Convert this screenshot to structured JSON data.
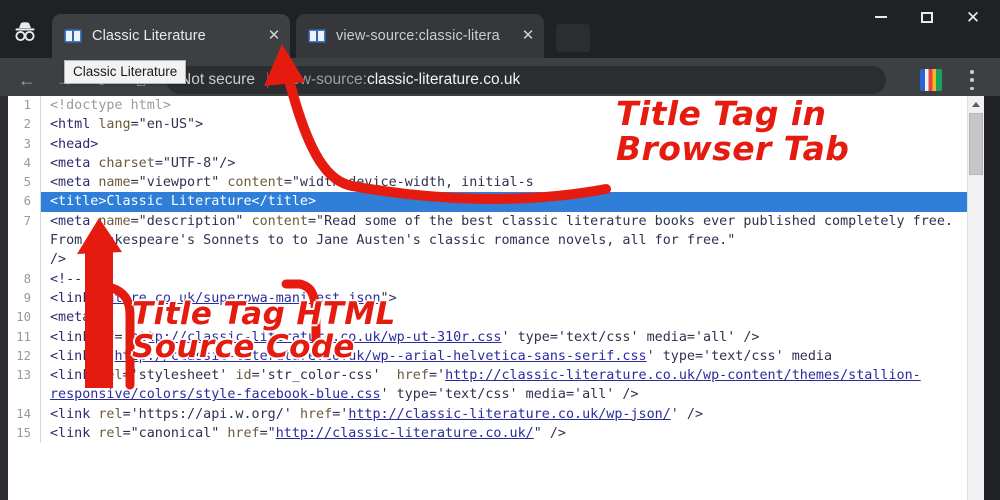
{
  "window": {
    "minimize_label": "Minimize",
    "maximize_label": "Maximize",
    "close_label": "Close",
    "close_glyph": "✕"
  },
  "browser": {
    "mode_icon": "incognito-icon",
    "tabs": [
      {
        "title": "Classic Literature",
        "favicon": "book-favicon",
        "close_glyph": "✕",
        "active": true
      },
      {
        "title": "view-source:classic-litera",
        "favicon": "book-favicon",
        "close_glyph": "✕",
        "active": false
      }
    ],
    "toolbar": {
      "back_glyph": "←",
      "forward_glyph": "→",
      "reload_glyph": "⟳",
      "home_glyph": "⌂",
      "security_label": "Not secure",
      "url_scheme": "view-source:",
      "url_host": "classic-literature.co.uk",
      "extension_icon": "extension-icon",
      "menu_icon": "three-dots-menu-icon"
    },
    "tooltip": "Classic Literature"
  },
  "annotations": [
    {
      "id": "tab-annotation",
      "text": "Title Tag in\nBrowser Tab",
      "color": "#e51b10"
    },
    {
      "id": "source-annotation",
      "text": "Title Tag HTML\nSource Code",
      "color": "#e51b10"
    }
  ],
  "source": {
    "lines": [
      {
        "num": "1",
        "segments": [
          {
            "t": "<!doctype html>",
            "c": "doctypec"
          }
        ]
      },
      {
        "num": "2",
        "segments": [
          {
            "t": "<html ",
            "c": "tagc"
          },
          {
            "t": "lang",
            "c": "attrc"
          },
          {
            "t": "=\"en-US\">",
            "c": "valc"
          }
        ]
      },
      {
        "num": "3",
        "segments": [
          {
            "t": "<head>",
            "c": "tagc"
          }
        ]
      },
      {
        "num": "4",
        "segments": [
          {
            "t": "<meta ",
            "c": "tagc"
          },
          {
            "t": "charset",
            "c": "attrc"
          },
          {
            "t": "=\"UTF-8\"/>",
            "c": "valc"
          }
        ]
      },
      {
        "num": "5",
        "segments": [
          {
            "t": "<meta ",
            "c": "tagc"
          },
          {
            "t": "name",
            "c": "attrc"
          },
          {
            "t": "=\"viewport\" ",
            "c": "valc"
          },
          {
            "t": "content",
            "c": "attrc"
          },
          {
            "t": "=\"width=device-width, initial-s",
            "c": "valc"
          }
        ]
      },
      {
        "num": "6",
        "selected": true,
        "segments": [
          {
            "t": "<title>Classic Literature</title>",
            "c": "tagc"
          }
        ]
      },
      {
        "num": "7",
        "segments": [
          {
            "t": "<meta ",
            "c": "tagc"
          },
          {
            "t": "name",
            "c": "attrc"
          },
          {
            "t": "=\"description\" ",
            "c": "valc"
          },
          {
            "t": "content",
            "c": "attrc"
          },
          {
            "t": "=\"Read some of the best classic literature books ever published completely free. From Shakespeare's Sonnets to to Jane Austen's classic romance novels, all for free.\"\n/>",
            "c": "valc"
          }
        ]
      },
      {
        "num": "8",
        "segments": [
          {
            "t": "<!-- ",
            "c": "tagc"
          }
        ]
      },
      {
        "num": "9",
        "segments": [
          {
            "t": "<link ",
            "c": "tagc"
          },
          {
            "t": "rature.co.uk/superpwa-manifest.json",
            "c": "linkc"
          },
          {
            "t": "\">",
            "c": "valc"
          }
        ]
      },
      {
        "num": "10",
        "segments": [
          {
            "t": "<meta ",
            "c": "tagc"
          }
        ]
      },
      {
        "num": "11",
        "segments": [
          {
            "t": "<link ",
            "c": "tagc"
          },
          {
            "t": "ef='",
            "c": "valc"
          },
          {
            "t": "http://classic-literature.co.uk/wp-ut-310r.css",
            "c": "linkc"
          },
          {
            "t": "' type='text/css' media='all' />",
            "c": "valc"
          }
        ]
      },
      {
        "num": "12",
        "segments": [
          {
            "t": "<link ",
            "c": "tagc"
          },
          {
            "t": "='",
            "c": "valc"
          },
          {
            "t": "http://classic-literature.co.uk/wp--arial-helvetica-sans-serif.css",
            "c": "linkc"
          },
          {
            "t": "' type='text/css' media",
            "c": "valc"
          }
        ]
      },
      {
        "num": "13",
        "segments": [
          {
            "t": "<link ",
            "c": "tagc"
          },
          {
            "t": "rel",
            "c": "attrc"
          },
          {
            "t": "='stylesheet' ",
            "c": "valc"
          },
          {
            "t": "id",
            "c": "attrc"
          },
          {
            "t": "='str_color-css'  ",
            "c": "valc"
          },
          {
            "t": "href",
            "c": "attrc"
          },
          {
            "t": "='",
            "c": "valc"
          },
          {
            "t": "http://classic-literature.co.uk/wp-content/themes/stallion-responsive/colors/style-facebook-blue.css",
            "c": "linkc"
          },
          {
            "t": "' type='text/css' media='all' />",
            "c": "valc"
          }
        ]
      },
      {
        "num": "14",
        "segments": [
          {
            "t": "<link ",
            "c": "tagc"
          },
          {
            "t": "rel",
            "c": "attrc"
          },
          {
            "t": "='https://api.w.org/' ",
            "c": "valc"
          },
          {
            "t": "href",
            "c": "attrc"
          },
          {
            "t": "='",
            "c": "valc"
          },
          {
            "t": "http://classic-literature.co.uk/wp-json/",
            "c": "linkc"
          },
          {
            "t": "' />",
            "c": "valc"
          }
        ]
      },
      {
        "num": "15",
        "segments": [
          {
            "t": "<link ",
            "c": "tagc"
          },
          {
            "t": "rel",
            "c": "attrc"
          },
          {
            "t": "=\"canonical\" ",
            "c": "valc"
          },
          {
            "t": "href",
            "c": "attrc"
          },
          {
            "t": "=\"",
            "c": "valc"
          },
          {
            "t": "http://classic-literature.co.uk/",
            "c": "linkc"
          },
          {
            "t": "\" />",
            "c": "valc"
          }
        ]
      }
    ]
  },
  "scrollbar": {
    "up_arrow": "scroll-up-arrow"
  }
}
